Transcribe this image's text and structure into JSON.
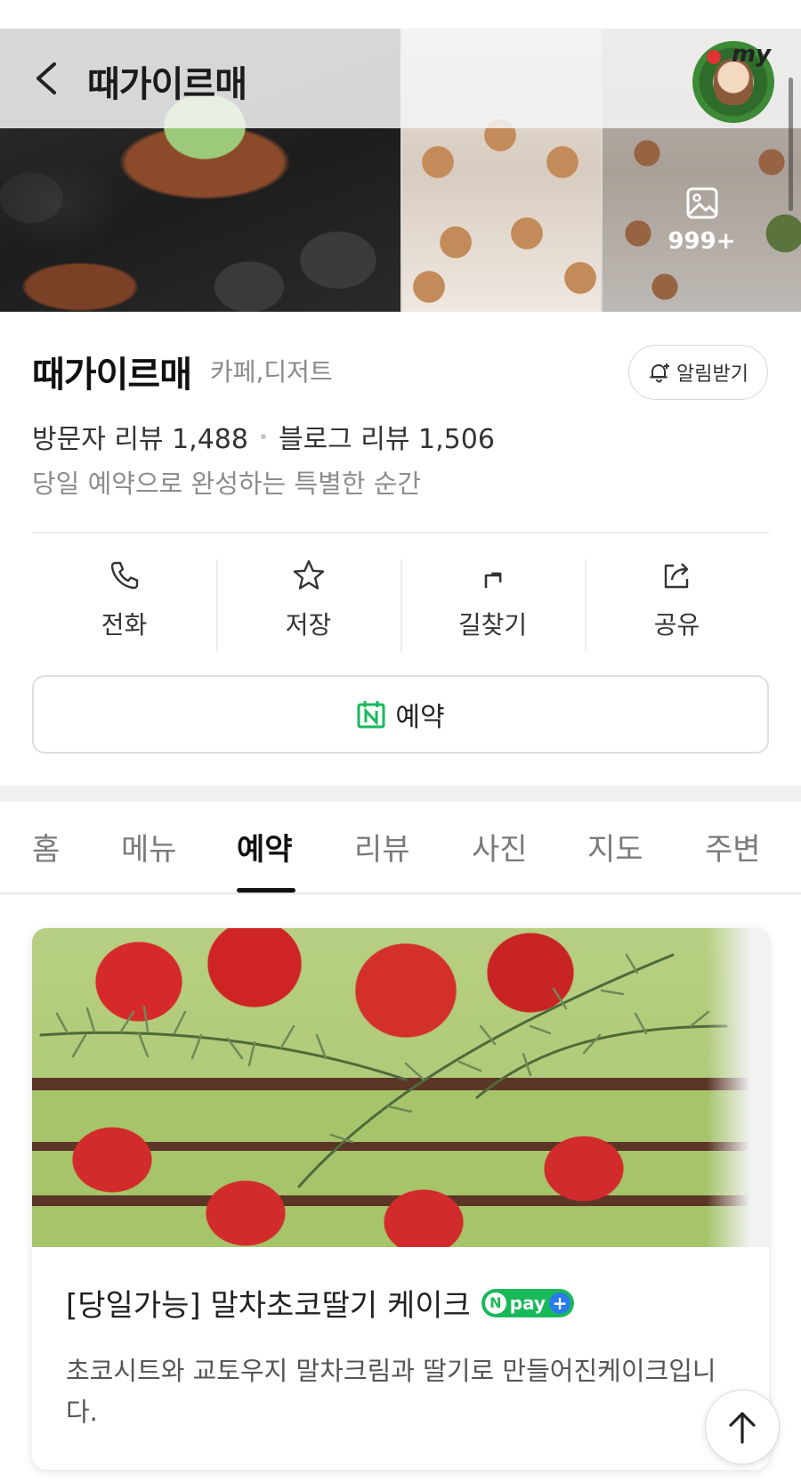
{
  "header": {
    "title": "때가이르매",
    "avatar_text": "my",
    "photo_count": "999+"
  },
  "place": {
    "name": "때가이르매",
    "category": "카페,디저트",
    "notify_label": "알림받기",
    "visitor_review": "방문자 리뷰 1,488",
    "blog_review": "블로그 리뷰 1,506",
    "tagline": "당일 예약으로 완성하는 특별한 순간"
  },
  "actions": [
    {
      "label": "전화",
      "icon": "phone-icon"
    },
    {
      "label": "저장",
      "icon": "star-icon"
    },
    {
      "label": "길찾기",
      "icon": "directions-icon"
    },
    {
      "label": "공유",
      "icon": "share-icon"
    }
  ],
  "reserve": {
    "label": "예약",
    "icon": "naver-calendar-icon"
  },
  "tabs": [
    {
      "label": "홈",
      "active": false
    },
    {
      "label": "메뉴",
      "active": false
    },
    {
      "label": "예약",
      "active": true
    },
    {
      "label": "리뷰",
      "active": false
    },
    {
      "label": "사진",
      "active": false
    },
    {
      "label": "지도",
      "active": false
    },
    {
      "label": "주변",
      "active": false
    }
  ],
  "product": {
    "title": "[당일가능] 말차초코딸기 케이크",
    "badge_n": "N",
    "badge_text": "pay",
    "badge_plus": "+",
    "description": "초코시트와 교토우지 말차크림과 딸기로 만들어진케이크입니다."
  },
  "colors": {
    "accent_green": "#19b95a",
    "npay_blue": "#2b7bea",
    "text_primary": "#111111",
    "text_secondary": "#8a8a8a"
  }
}
